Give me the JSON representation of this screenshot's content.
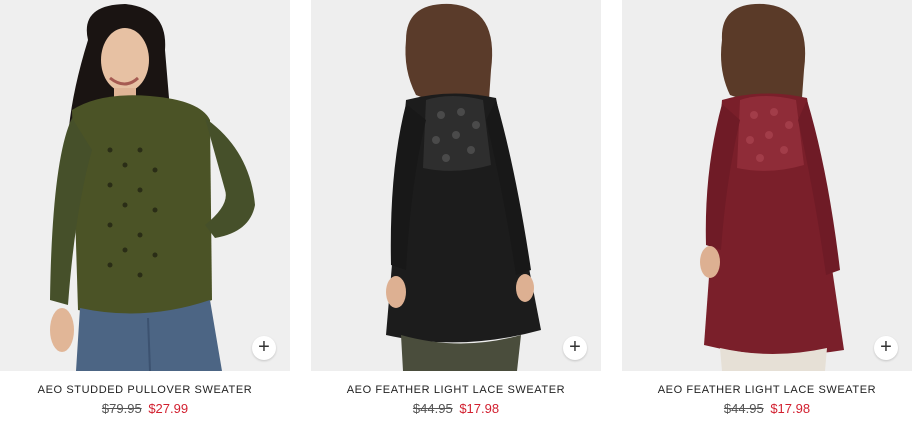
{
  "products": [
    {
      "name": "AEO STUDDED PULLOVER SWEATER",
      "original_price": "$79.95",
      "sale_price": "$27.99",
      "sweater_color": "#4b5326",
      "photo_bg": "#efefef",
      "quick_add_icon": "plus-icon"
    },
    {
      "name": "AEO FEATHER LIGHT LACE SWEATER",
      "original_price": "$44.95",
      "sale_price": "$17.98",
      "sweater_color": "#1c1c1c",
      "photo_bg": "#eeeeee",
      "quick_add_icon": "plus-icon"
    },
    {
      "name": "AEO FEATHER LIGHT LACE SWEATER",
      "original_price": "$44.95",
      "sale_price": "$17.98",
      "sweater_color": "#7a1f2a",
      "photo_bg": "#eeeeee",
      "quick_add_icon": "plus-icon"
    }
  ],
  "quick_add_symbol": "+",
  "sale_price_color": "#d21f2f"
}
